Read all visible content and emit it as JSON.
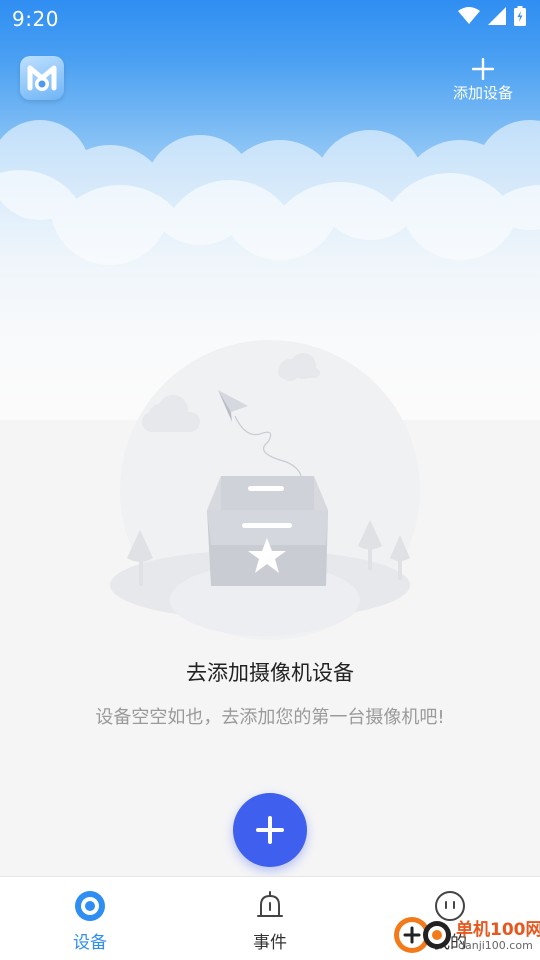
{
  "status_bar": {
    "time": "9:20"
  },
  "header": {
    "logo_icon": "app-logo-icon",
    "add_device_label": "添加设备"
  },
  "empty_state": {
    "title": "去添加摄像机设备",
    "subtitle": "设备空空如也，去添加您的第一台摄像机吧!"
  },
  "fab": {
    "icon": "plus-icon"
  },
  "tabs": [
    {
      "label": "设备",
      "icon": "device-eye-icon",
      "active": true
    },
    {
      "label": "事件",
      "icon": "bell-icon",
      "active": false
    },
    {
      "label": "我的",
      "icon": "profile-icon",
      "active": false
    }
  ],
  "watermark": {
    "brand": "单机100网",
    "url": "danji100.com"
  },
  "colors": {
    "primary": "#3f5fee",
    "accent": "#2f8ef2",
    "header_top": "#2f8ef2"
  }
}
